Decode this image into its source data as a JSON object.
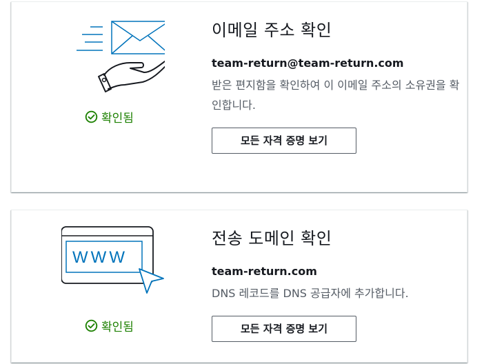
{
  "cards": [
    {
      "title": "이메일 주소 확인",
      "identity": "team-return@team-return.com",
      "description": "받은 편지함을 확인하여 이 이메일 주소의 소유권을 확인합니다.",
      "status": "확인됨",
      "button_label": "모든 자격 증명 보기",
      "illustration_icon": "email-hand-icon"
    },
    {
      "title": "전송 도메인 확인",
      "identity": "team-return.com",
      "description": "DNS 레코드를 DNS 공급자에 추가합니다.",
      "status": "확인됨",
      "button_label": "모든 자격 증명 보기",
      "illustration_icon": "browser-www-icon",
      "illustration_text": "WWW"
    }
  ],
  "colors": {
    "status_green": "#1d8102",
    "illustration_blue": "#0073bb",
    "illustration_dark": "#16191f",
    "text_secondary": "#545b64"
  }
}
